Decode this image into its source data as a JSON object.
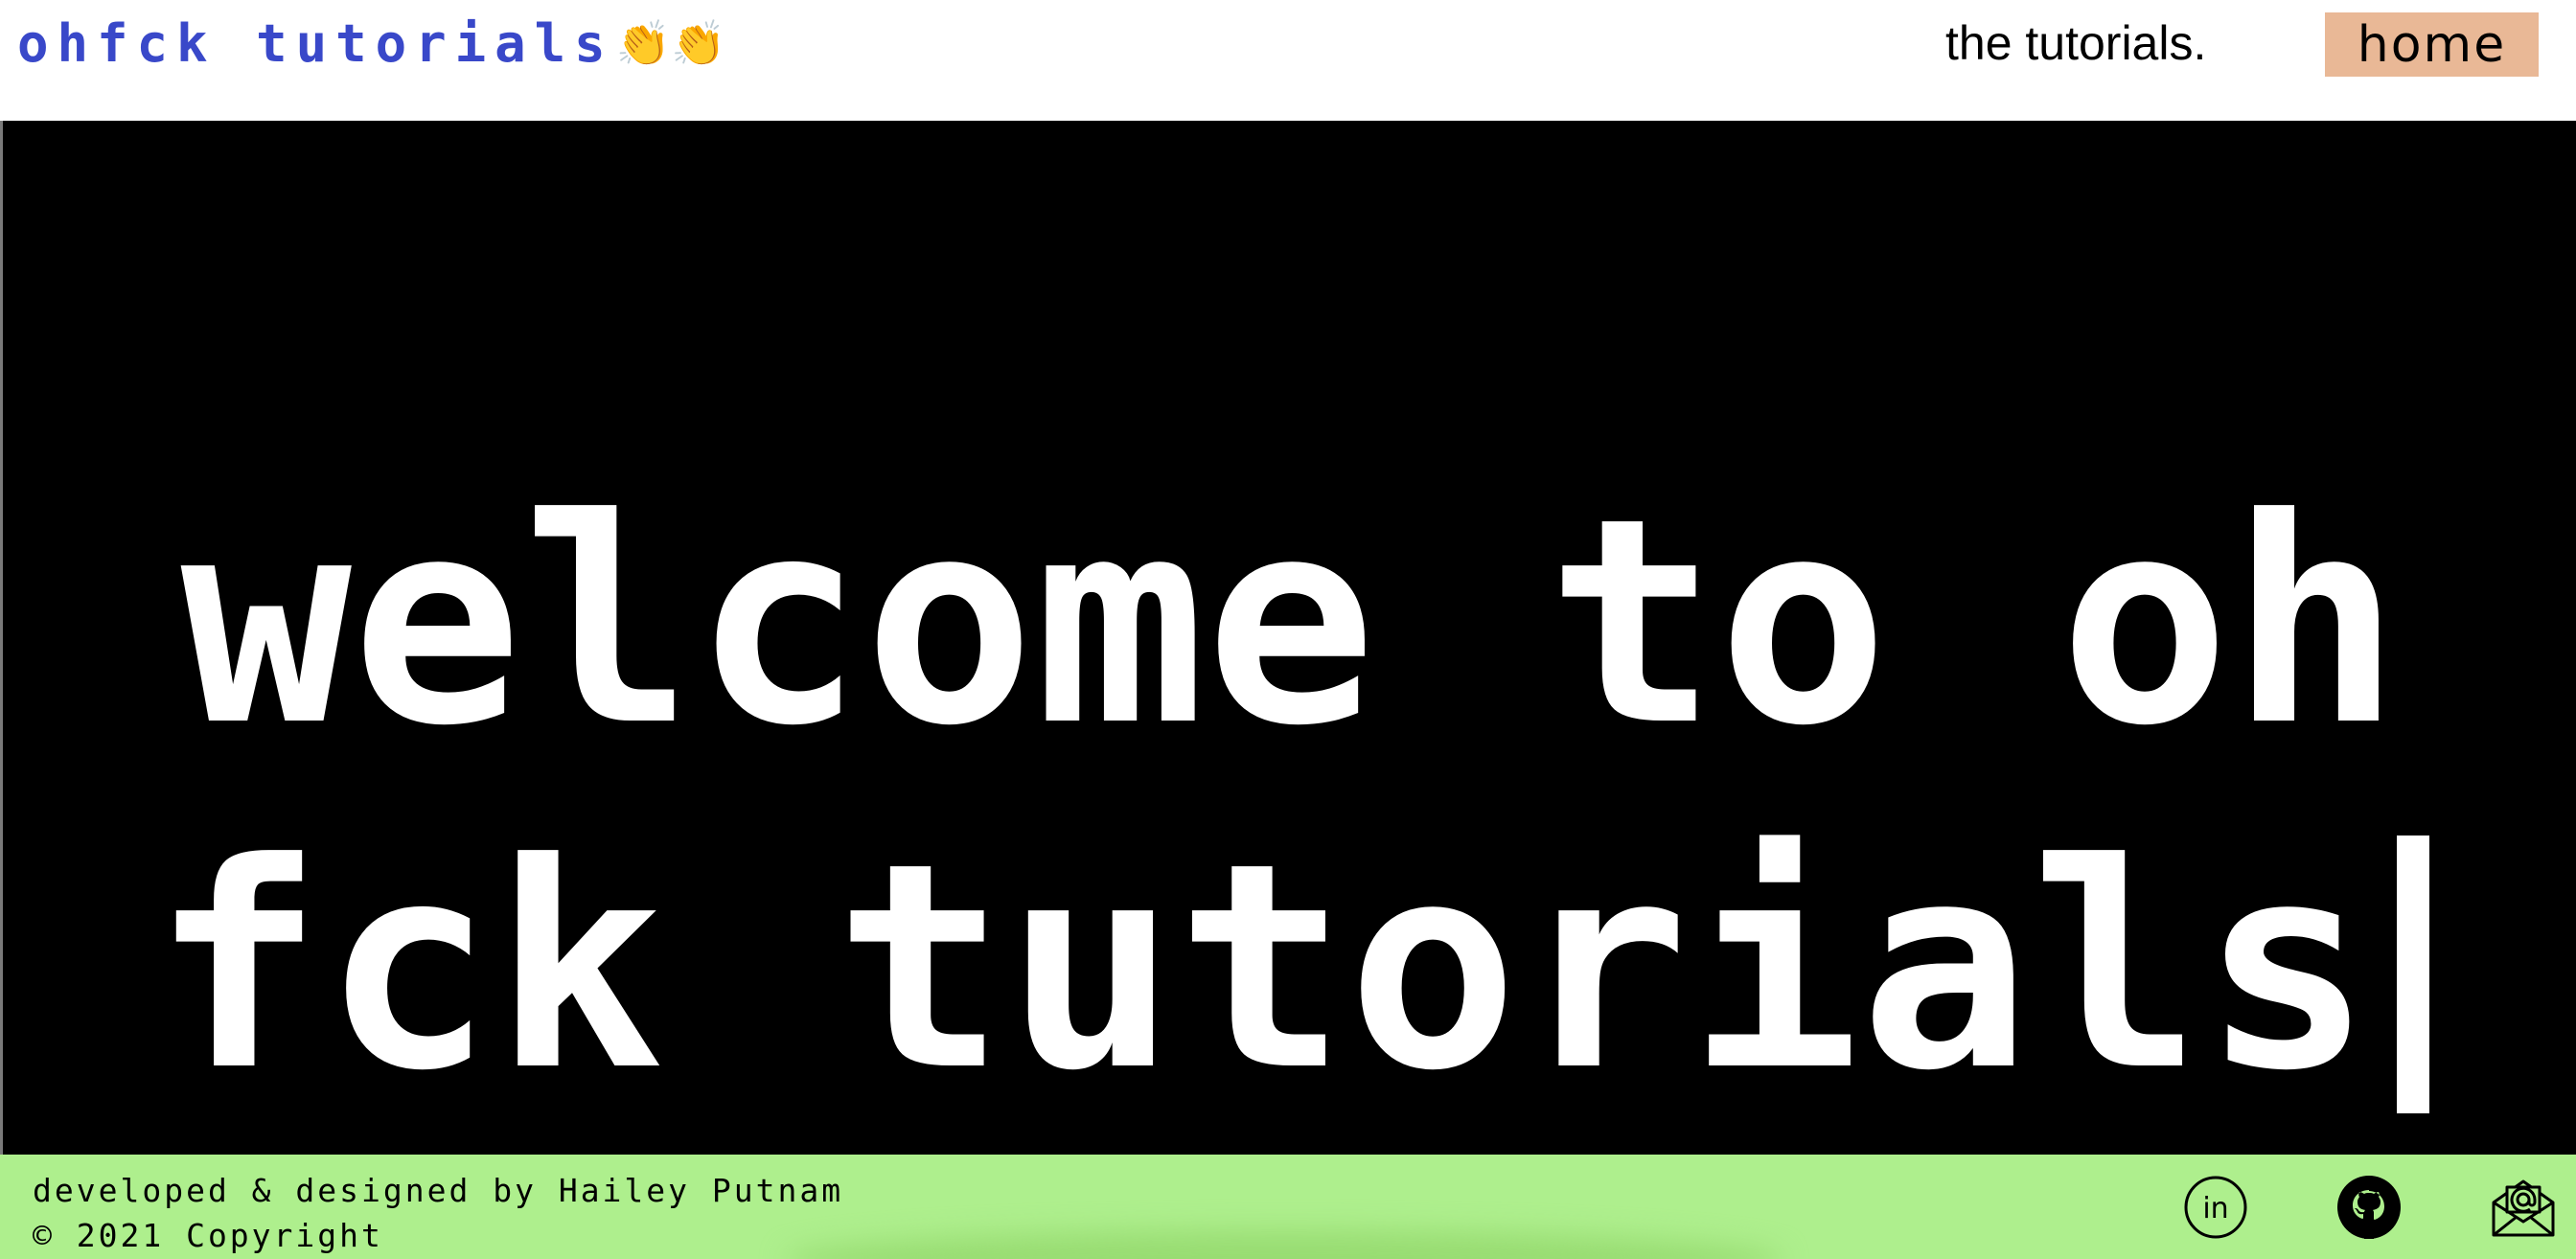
{
  "header": {
    "brand_text": "ohfck tutorials",
    "brand_emoji": "👏👏",
    "nav_link": "the tutorials.",
    "home_button": "home",
    "home_button_color": "#e9b896",
    "brand_color": "#3948c9"
  },
  "hero": {
    "line1": "welcome to oh",
    "line2": "fck tutorials",
    "background": "#000000",
    "text_color": "#ffffff"
  },
  "footer": {
    "credit": "developed & designed by Hailey Putnam",
    "copyright": "© 2021 Copyright",
    "background": "#aeef8d",
    "icons": [
      "linkedin-icon",
      "github-icon",
      "email-icon"
    ]
  }
}
